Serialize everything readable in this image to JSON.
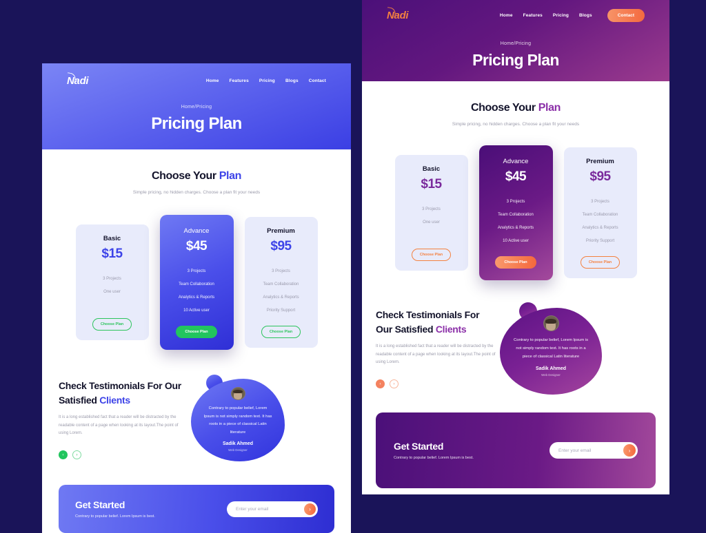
{
  "page": {
    "background_color": "#1a1459"
  },
  "brand": {
    "logo_text": "Nadi",
    "blue_accent": "#3d43e8",
    "purple_accent": "#8b2fa8",
    "green_accent": "#22c55e",
    "orange_accent": "#f4683c"
  },
  "left_panel": {
    "theme": "blue-green",
    "nav": {
      "links": [
        {
          "label": "Home"
        },
        {
          "label": "Features"
        },
        {
          "label": "Pricing"
        },
        {
          "label": "Blogs"
        },
        {
          "label": "Contact"
        }
      ]
    },
    "hero": {
      "breadcrumb": "Home/Pricing",
      "title": "Pricing Plan"
    },
    "pricing": {
      "heading_normal": "Choose Your ",
      "heading_accent": "Plan",
      "subtitle": "Simple pricing, no hidden charges. Choose a plan fit your needs",
      "plans": [
        {
          "name": "Basic",
          "price": "$15",
          "features": [
            "3 Projects",
            "One user"
          ],
          "cta": "Choose Plan",
          "featured": false
        },
        {
          "name": "Advance",
          "price": "$45",
          "features": [
            "3 Projects",
            "Team Collaboration",
            "Analytics & Reports",
            "10 Active user"
          ],
          "cta": "Choose Plan",
          "featured": true
        },
        {
          "name": "Premium",
          "price": "$95",
          "features": [
            "3 Projects",
            "Team Collaboration",
            "Analytics & Reports",
            "Priority Support"
          ],
          "cta": "Choose Plan",
          "featured": false
        }
      ]
    },
    "testimonials": {
      "heading_line1": "Check Testimonials For Our",
      "heading_line2_normal": "Satisfied ",
      "heading_line2_accent": "Clients",
      "body": "It is a long established fact that a reader will be distracted by the readable content of a page when looking at its layout.The point of using Lorem.",
      "prev_glyph": "‹",
      "next_glyph": "›",
      "quote": "Contrary to popular belief, Lorem Ipsum is not simply random text. It has roots in a piece of classical Latin literature",
      "author": "Sadik Ahmed",
      "role": "Web Designer"
    },
    "cta": {
      "title": "Get Started",
      "subtitle": "Contrary to popular belief. Lorem Ipsum is best.",
      "email_placeholder": "Enter your email",
      "email_value": "",
      "submit_glyph": "›"
    }
  },
  "right_panel": {
    "theme": "purple-orange",
    "nav": {
      "links": [
        {
          "label": "Home"
        },
        {
          "label": "Features"
        },
        {
          "label": "Pricing"
        },
        {
          "label": "Blogs"
        }
      ],
      "cta_label": "Contact"
    },
    "hero": {
      "breadcrumb": "Home/Pricing",
      "title": "Pricing Plan"
    },
    "pricing": {
      "heading_normal": "Choose Your ",
      "heading_accent": "Plan",
      "subtitle": "Simple pricing, no hidden charges. Choose a plan fit your needs",
      "plans": [
        {
          "name": "Basic",
          "price": "$15",
          "features": [
            "3 Projects",
            "One user"
          ],
          "cta": "Choose Plan",
          "featured": false
        },
        {
          "name": "Advance",
          "price": "$45",
          "features": [
            "3 Projects",
            "Team Collaboration",
            "Analytics & Reports",
            "10 Active user"
          ],
          "cta": "Choose Plan",
          "featured": true
        },
        {
          "name": "Premium",
          "price": "$95",
          "features": [
            "3 Projects",
            "Team Collaboration",
            "Analytics & Reports",
            "Priority Support"
          ],
          "cta": "Choose Plan",
          "featured": false
        }
      ]
    },
    "testimonials": {
      "heading_line1": "Check Testimonials For",
      "heading_line2_normal": "Our Satisfied ",
      "heading_line2_accent": "Clients",
      "body": "It is a long established fact that a reader will be distracted by the readable content of a page when looking at its layout.The point of using Lorem.",
      "prev_glyph": "‹",
      "next_glyph": "›",
      "quote": "Contrary to popular belief, Lorem Ipsum is not simply random text. It has roots in a piece of classical Latin literature",
      "author": "Sadik Ahmed",
      "role": "Web Designer"
    },
    "cta": {
      "title": "Get Started",
      "subtitle": "Contrary to popular belief. Lorem Ipsum is best.",
      "email_placeholder": "Enter your email",
      "email_value": "",
      "submit_glyph": "›"
    }
  }
}
